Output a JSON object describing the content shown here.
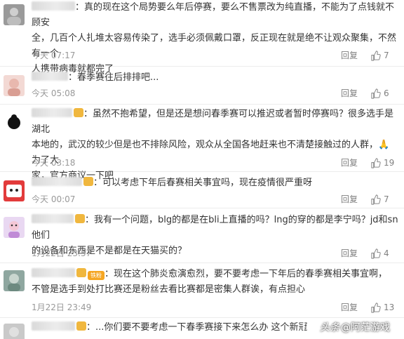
{
  "comments": [
    {
      "text_lines": [
        "：真的现在这个局势要么年后停赛，要么不售票改为纯直播，不能为了点钱就不顾安",
        "全，几百个人扎堆太容易传染了，选手必须佩戴口罩，反正现在就是绝不让观众聚集，不然有一个",
        "人携带病毒就都完了"
      ],
      "time": "今天 07:17",
      "reply_label": "回复",
      "likes": "7"
    },
    {
      "text_lines": [
        "：春季赛往后排排吧..."
      ],
      "time": "今天 05:08",
      "reply_label": "回复",
      "likes": "6"
    },
    {
      "text_lines": [
        "：虽然不抱希望，但是还是想问春季赛可以推迟或者暂时停赛吗？很多选手是湖北",
        "本地的，武汉的较少但是也不排除风险，观众从全国各地赶来也不清楚接触过的人群，",
        "家，官方商议一下吧"
      ],
      "emoji_tail": "为了大",
      "time": "今天 03:18",
      "reply_label": "回复",
      "likes": "19"
    },
    {
      "text_lines": [
        "：可以考虑下年后春赛相关事宜吗，现在疫情很严重呀"
      ],
      "time": "今天 00:07",
      "reply_label": "回复",
      "likes": "7"
    },
    {
      "text_lines": [
        "：我有一个问题，blg的都是在bli上直播的吗？lng的穿的都是李宁吗？jd和sn他们",
        "的设备和东西是不是都是在天猫买的？"
      ],
      "time": "1月22日 23:57",
      "reply_label": "回复",
      "likes": "4"
    },
    {
      "text_lines": [
        "：现在这个肺炎愈演愈烈，要不要考虑一下年后的春季赛相关事宜啊，",
        "不管是选手到处打比赛还是粉丝去看比赛都是密集人群诶，有点担心"
      ],
      "badge_text": "铁粉",
      "time": "1月22日 23:49",
      "reply_label": "回复",
      "likes": "13"
    },
    {
      "text_lines": [
        "：...你们要不要考虑一下春季赛接下来怎么办 这个新冠"
      ],
      "time": "",
      "reply_label": "",
      "likes": ""
    }
  ],
  "watermark": {
    "platform": "头条",
    "account": "@阿茫游戏"
  },
  "colors": {
    "username": "#eb7350",
    "meta": "#999999",
    "divider": "#ececec"
  },
  "icons": [
    "thumbs-up-icon",
    "pray-hands-emoji",
    "vip-badge-icon",
    "toutiao-logo-icon"
  ]
}
